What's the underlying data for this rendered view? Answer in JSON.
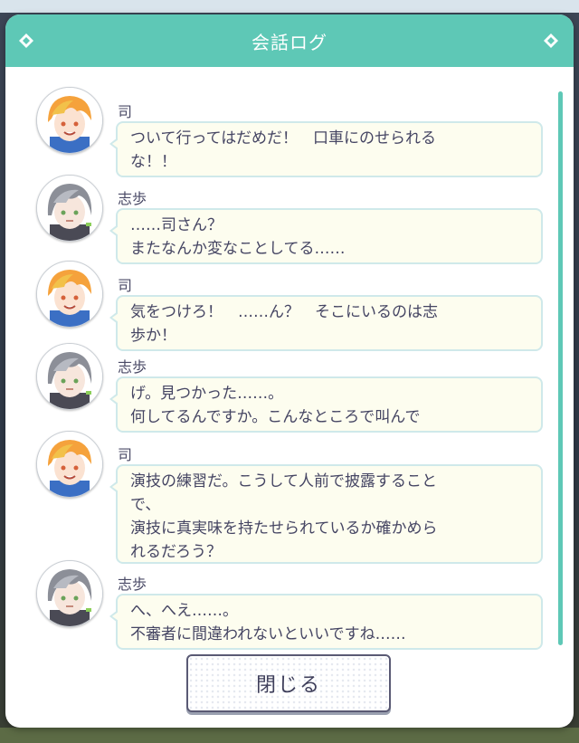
{
  "header": {
    "title": "会話ログ"
  },
  "colors": {
    "accent": "#5ec8b6",
    "bubble_bg": "#fdfdef",
    "bubble_border": "#cfe9ea",
    "text": "#454563"
  },
  "log": {
    "entries": [
      {
        "speaker": "司",
        "character": "tsukasa",
        "lines": [
          "ついて行ってはだめだ！　口車にのせられる",
          "な！！"
        ]
      },
      {
        "speaker": "志歩",
        "character": "shiho",
        "lines": [
          "……司さん？",
          "またなんか変なことしてる……"
        ]
      },
      {
        "speaker": "司",
        "character": "tsukasa",
        "lines": [
          "気をつけろ！　……ん？　そこにいるのは志",
          "歩か！"
        ]
      },
      {
        "speaker": "志歩",
        "character": "shiho",
        "lines": [
          "げ。見つかった……。",
          "何してるんですか。こんなところで叫んで"
        ]
      },
      {
        "speaker": "司",
        "character": "tsukasa",
        "lines": [
          "演技の練習だ。こうして人前で披露すること",
          "で、",
          "演技に真実味を持たせられているか確かめら",
          "れるだろう？"
        ]
      },
      {
        "speaker": "志歩",
        "character": "shiho",
        "lines": [
          "へ、へえ……。",
          "不審者に間違われないといいですね……"
        ]
      }
    ]
  },
  "footer": {
    "close_label": "閉じる"
  }
}
